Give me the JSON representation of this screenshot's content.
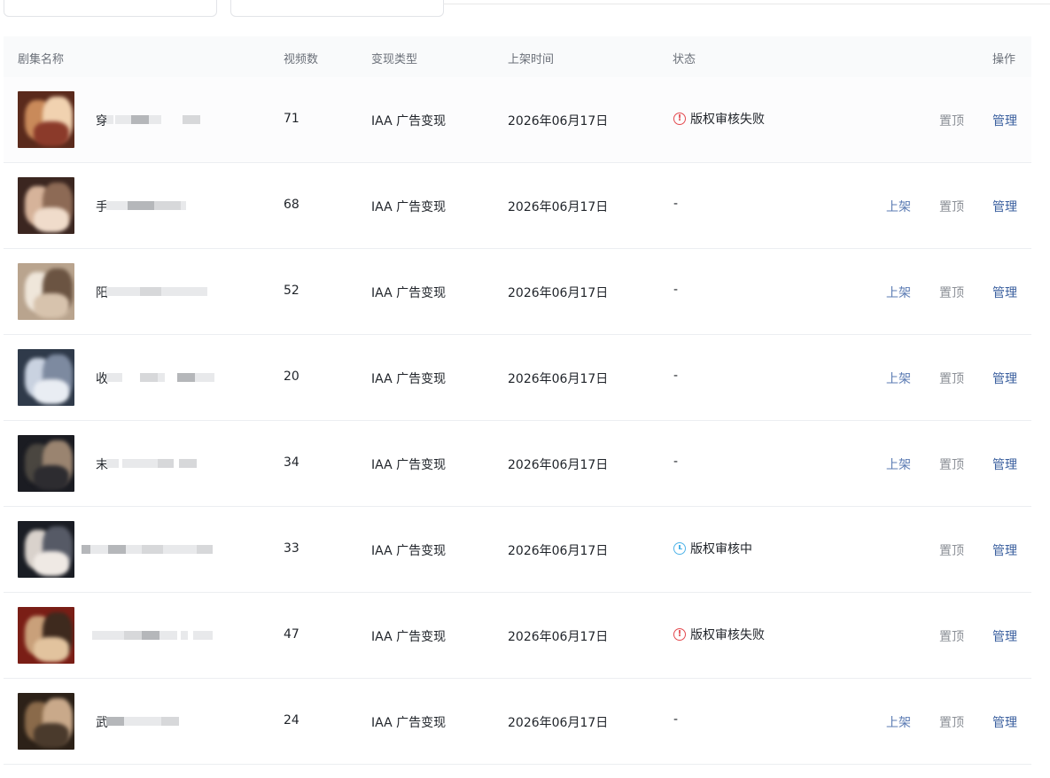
{
  "table": {
    "headers": {
      "name": "剧集名称",
      "count": "视频数",
      "monetize": "变现类型",
      "listed": "上架时间",
      "status": "状态",
      "ops": "操作"
    },
    "actions": {
      "list": "上架",
      "pin": "置顶",
      "manage": "管理"
    },
    "status_colors": {
      "fail": "#e3484e",
      "pending": "#4fb3e8"
    },
    "rows": [
      {
        "title": "穿",
        "count": "71",
        "type": "IAA 广告变现",
        "date": "2026年06月17日",
        "status": "版权审核失败",
        "status_kind": "fail",
        "can_list": false,
        "thumb": [
          "#5a2a1c",
          "#c98a5a",
          "#f1d2b0",
          "#8b3a2a"
        ]
      },
      {
        "title": "手",
        "count": "68",
        "type": "IAA 广告变现",
        "date": "2026年06月17日",
        "status": "-",
        "status_kind": "none",
        "can_list": true,
        "thumb": [
          "#3b2620",
          "#d6b39a",
          "#8d6a55",
          "#f0dccb"
        ]
      },
      {
        "title": "阳",
        "count": "52",
        "type": "IAA 广告变现",
        "date": "2026年06月17日",
        "status": "-",
        "status_kind": "none",
        "can_list": true,
        "thumb": [
          "#b9a48e",
          "#efe6da",
          "#6b5442",
          "#d7c3ad"
        ]
      },
      {
        "title": "收",
        "count": "20",
        "type": "IAA 广告变现",
        "date": "2026年06月17日",
        "status": "-",
        "status_kind": "none",
        "can_list": true,
        "thumb": [
          "#2f3a4a",
          "#c9d2e0",
          "#7d8aa0",
          "#e9edf3"
        ]
      },
      {
        "title": "末",
        "count": "34",
        "type": "IAA 广告变现",
        "date": "2026年06月17日",
        "status": "-",
        "status_kind": "none",
        "can_list": true,
        "thumb": [
          "#1b1c22",
          "#4a4640",
          "#9a8470",
          "#2d2c30"
        ]
      },
      {
        "title": "",
        "count": "33",
        "type": "IAA 广告变现",
        "date": "2026年06月17日",
        "status": "版权审核中",
        "status_kind": "pending",
        "can_list": false,
        "thumb": [
          "#1a1d24",
          "#d9d2cc",
          "#565a66",
          "#efe9e4"
        ]
      },
      {
        "title": "",
        "count": "47",
        "type": "IAA 广告变现",
        "date": "2026年06月17日",
        "status": "版权审核失败",
        "status_kind": "fail",
        "can_list": false,
        "thumb": [
          "#7a1e16",
          "#c9a07a",
          "#3e2a1e",
          "#e2c39e"
        ]
      },
      {
        "title": "武",
        "count": "24",
        "type": "IAA 广告变现",
        "date": "2026年06月17日",
        "status": "-",
        "status_kind": "none",
        "can_list": true,
        "thumb": [
          "#2c2118",
          "#8a6a4a",
          "#c9a98a",
          "#4a3a2c"
        ]
      }
    ]
  }
}
